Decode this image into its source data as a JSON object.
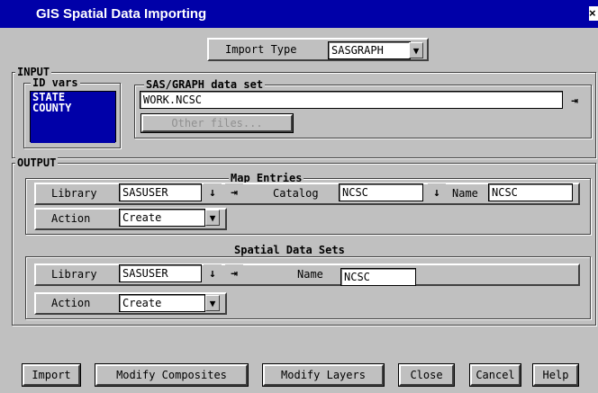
{
  "window": {
    "title": "GIS Spatial Data Importing",
    "close_glyph": "×"
  },
  "import_type": {
    "label": "Import Type",
    "value": "SASGRAPH"
  },
  "input": {
    "title": "INPUT",
    "id_vars": {
      "title": "ID vars",
      "items": [
        "STATE",
        "COUNTY"
      ]
    },
    "sasgraph": {
      "title": "SAS/GRAPH data set",
      "value": "WORK.NCSC",
      "other_files_label": "Other files..."
    }
  },
  "output": {
    "title": "OUTPUT",
    "map_entries": {
      "title": "Map Entries",
      "library_label": "Library",
      "library_value": "SASUSER",
      "catalog_label": "Catalog",
      "catalog_value": "NCSC",
      "name_label": "Name",
      "name_value": "NCSC",
      "action_label": "Action",
      "action_value": "Create"
    },
    "spatial": {
      "title": "Spatial Data Sets",
      "library_label": "Library",
      "library_value": "SASUSER",
      "name_label": "Name",
      "name_value": "NCSC",
      "action_label": "Action",
      "action_value": "Create"
    }
  },
  "buttons": {
    "import": "Import",
    "modify_composites": "Modify Composites",
    "modify_layers": "Modify Layers",
    "close": "Close",
    "cancel": "Cancel",
    "help": "Help"
  },
  "icons": {
    "dropdown": "dropdown-arrow-icon",
    "down": "down-arrow-icon",
    "select": "arrow-to-bar-icon"
  },
  "colors": {
    "title_bar": "#0000a8",
    "selection": "#0000a8",
    "background": "#c0c0c0"
  }
}
